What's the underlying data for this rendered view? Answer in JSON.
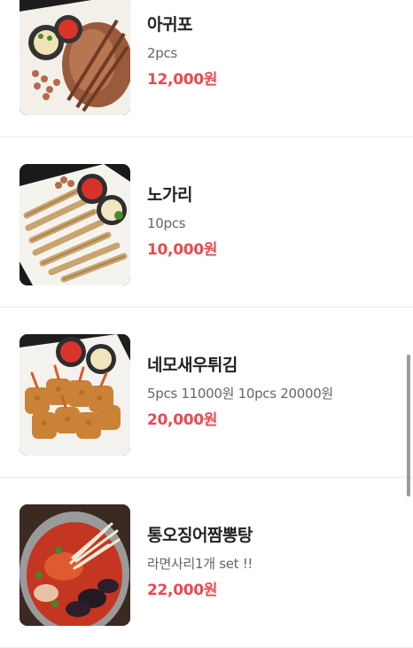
{
  "menu": {
    "items": [
      {
        "name": "아귀포",
        "desc": "2pcs",
        "price": "12,000원",
        "photo": "dried-monkfish-photo"
      },
      {
        "name": "노가리",
        "desc": "10pcs",
        "price": "10,000원",
        "photo": "dried-pollock-photo"
      },
      {
        "name": "네모새우튀김",
        "desc": "5pcs 11000원 10pcs 20000원",
        "price": "20,000원",
        "photo": "fried-shrimp-photo"
      },
      {
        "name": "통오징어짬뽕탕",
        "desc": "라면사리1개 set !!",
        "price": "22,000원",
        "photo": "squid-jjamppong-stew-photo"
      }
    ]
  },
  "colors": {
    "price": "#e84a4f",
    "title": "#222222",
    "description": "#666666",
    "divider": "#ececec",
    "scrollbar": "#9a9a9a"
  }
}
